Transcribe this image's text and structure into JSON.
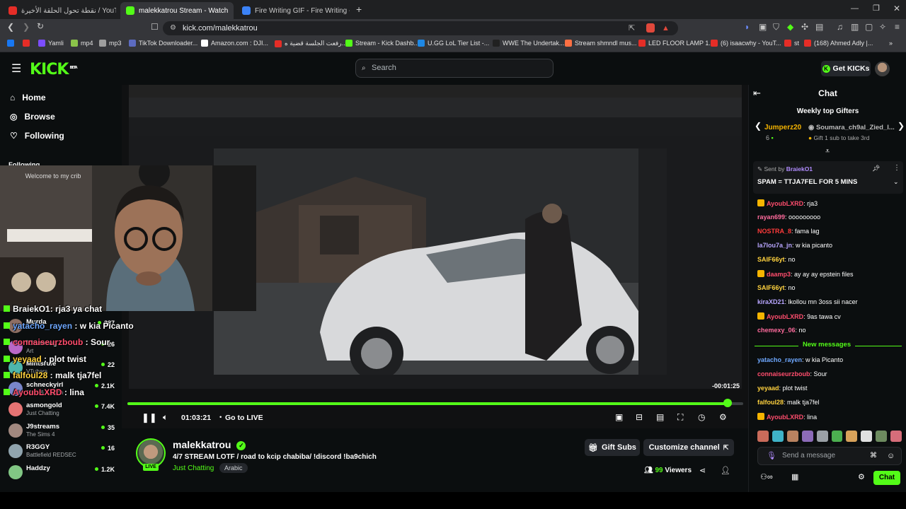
{
  "browser": {
    "tabs": [
      {
        "title": "نقطة تحول الحلقة الأخيرة / YouTube -",
        "active": false,
        "favicon_color": "#e52d27"
      },
      {
        "title": "malekkatrou Stream - Watch",
        "active": true,
        "favicon_color": "#53fc18"
      },
      {
        "title": "Fire Writing GIF - Fire Writing - Disco",
        "active": false,
        "favicon_color": "#3b82f6"
      }
    ],
    "new_tab": "+",
    "url": "kick.com/malekkatrou",
    "bookmarks": [
      {
        "label": "",
        "color": "#1877f2"
      },
      {
        "label": "",
        "color": "#e52d27"
      },
      {
        "label": "Yamli",
        "color": "#7c4dff"
      },
      {
        "label": "mp4",
        "color": "#8bc34a"
      },
      {
        "label": "mp3",
        "color": "#9e9e9e"
      },
      {
        "label": "TikTok Downloader...",
        "color": "#5c6bc0"
      },
      {
        "label": "Amazon.com : DJI...",
        "color": "#ffffff"
      },
      {
        "label": "رفعت الجلسة قضية ه...",
        "color": "#e52d27"
      },
      {
        "label": "Stream - Kick Dashb...",
        "color": "#53fc18"
      },
      {
        "label": "U.GG LoL Tier List -...",
        "color": "#1e88e5"
      },
      {
        "label": "WWE The Undertak...",
        "color": "#212121"
      },
      {
        "label": "Stream shmndl mus...",
        "color": "#ff7043"
      },
      {
        "label": "LED FLOOR LAMP 1...",
        "color": "#e52d27"
      },
      {
        "label": "(6) isaacwhy - YouT...",
        "color": "#e52d27"
      },
      {
        "label": "st",
        "color": "#e52d27"
      },
      {
        "label": "(168) Ahmed Adly |...",
        "color": "#e52d27"
      }
    ],
    "bookmarks_more": "»"
  },
  "kick": {
    "logo": "KICK",
    "logo_tag": "BETA",
    "search_placeholder": "Search",
    "get_kicks": "Get KICKs"
  },
  "sidebar": {
    "nav": [
      {
        "label": "Home",
        "icon": "home-icon"
      },
      {
        "label": "Browse",
        "icon": "compass-icon"
      },
      {
        "label": "Following",
        "icon": "heart-icon"
      }
    ],
    "following_header": "Following",
    "following": [
      {
        "name": "Murda",
        "category": "",
        "viewers": "387",
        "color": "#8d6e63"
      },
      {
        "name": "Kittencog",
        "category": "Art",
        "viewers": "26",
        "color": "#ba68c8"
      },
      {
        "name": "Mintsrule",
        "category": "VTubers",
        "viewers": "22",
        "color": "#4db6ac"
      },
      {
        "name": "schneckyirl",
        "category": "Slots & Casino",
        "viewers": "2.1K",
        "color": "#7986cb"
      },
      {
        "name": "asmongold",
        "category": "Just Chatting",
        "viewers": "7.4K",
        "color": "#e57373"
      },
      {
        "name": "J9streams",
        "category": "The Sims 4",
        "viewers": "35",
        "color": "#a1887f"
      },
      {
        "name": "R3GGY",
        "category": "Battlefield REDSEC",
        "viewers": "16",
        "color": "#90a4ae"
      },
      {
        "name": "Haddzy",
        "category": "",
        "viewers": "1.2K",
        "color": "#81c784"
      }
    ]
  },
  "webcam": {
    "caption": "Welcome to my crib"
  },
  "video_overlay_chat": [
    {
      "user": "BraiekO1",
      "text": ": rja3 ya chat",
      "color": "#ffffff"
    },
    {
      "user": "yatacho_rayen",
      "text": " : w kia Picanto",
      "color": "#6ea8ff"
    },
    {
      "user": "connaiseurzboub",
      "text": " : Sour",
      "color": "#ff4d6d"
    },
    {
      "user": "yeyaad",
      "text": " : plot twist",
      "color": "#ffd23f"
    },
    {
      "user": "falfoul28",
      "text": " : malk tja7fel",
      "color": "#ffd23f"
    },
    {
      "user": "AyoubLXRD",
      "text": " : lina",
      "color": "#ff4d6d"
    }
  ],
  "player": {
    "progress_fraction": 0.975,
    "remaining": "-00:01:25",
    "time": "01:03:21",
    "go_live": "Go to LIVE"
  },
  "stream": {
    "live_badge": "LIVE",
    "streamer": "malekkatrou",
    "title": "4/7 STREAM LOTF / road to kcip chabiba/ !discord !ba9chich",
    "category": "Just Chatting",
    "language": "Arabic",
    "gift_subs": "Gift Subs",
    "customize": "Customize channel",
    "viewers_count": "99",
    "viewers_label": "Viewers"
  },
  "chat": {
    "title": "Chat",
    "gifters_title": "Weekly top Gifters",
    "gifter1_name": "Jumperz20",
    "gifter1_count": "6",
    "gifter2_name": "Soumara_ch9al_Zied_l...",
    "gifter2_sub": "Gift 1 sub to take 3rd",
    "pinned_sent_by": "Sent by",
    "pinned_user": "BraiekO1",
    "pinned_text": "SPAM = TTJA7FEL FOR 5 MINS",
    "messages": [
      {
        "user": "AyoubLXRD",
        "text": ": rja3",
        "color": "#ff4d6d",
        "badge": true
      },
      {
        "user": "rayan699",
        "text": ": ooooooooo",
        "color": "#ff6b9d",
        "badge": false
      },
      {
        "user": "NOSTRA_8",
        "text": ": fama lag",
        "color": "#ff3b3b",
        "badge": false
      },
      {
        "user": "la7lou7a_jn",
        "text": ": w kia picanto",
        "color": "#b8a6ff",
        "badge": false
      },
      {
        "user": "SAIF66yt",
        "text": ": no",
        "color": "#ffd23f",
        "badge": false
      },
      {
        "user": "daamp3",
        "text": ": ay ay ay epstein files",
        "color": "#ff4d6d",
        "badge": true
      },
      {
        "user": "SAIF66yt",
        "text": ": no",
        "color": "#ffd23f",
        "badge": false
      },
      {
        "user": "kiraXD21",
        "text": ": lkollou mn 3oss sii nacer",
        "color": "#b8a6ff",
        "badge": false
      },
      {
        "user": "AyoubLXRD",
        "text": ": 9as tawa cv",
        "color": "#ff4d6d",
        "badge": true
      },
      {
        "user": "chemexy_06",
        "text": ": no",
        "color": "#ff6b9d",
        "badge": false
      }
    ],
    "new_messages": "New messages",
    "new_list": [
      {
        "user": "yatacho_rayen",
        "text": ": w kia Picanto",
        "color": "#6ea8ff",
        "badge": false
      },
      {
        "user": "connaiseurzboub",
        "text": ": Sour",
        "color": "#ff4d6d",
        "badge": false
      },
      {
        "user": "yeyaad",
        "text": ": plot twist",
        "color": "#ffd23f",
        "badge": false
      },
      {
        "user": "falfoul28",
        "text": ": malk tja7fel",
        "color": "#ffd23f",
        "badge": false
      },
      {
        "user": "AyoubLXRD",
        "text": ": lina",
        "color": "#ff4d6d",
        "badge": true
      }
    ],
    "input_placeholder": "Send a message",
    "send_label": "Chat"
  },
  "colors": {
    "accent": "#53fc18",
    "bg": "#0b0e0f"
  }
}
